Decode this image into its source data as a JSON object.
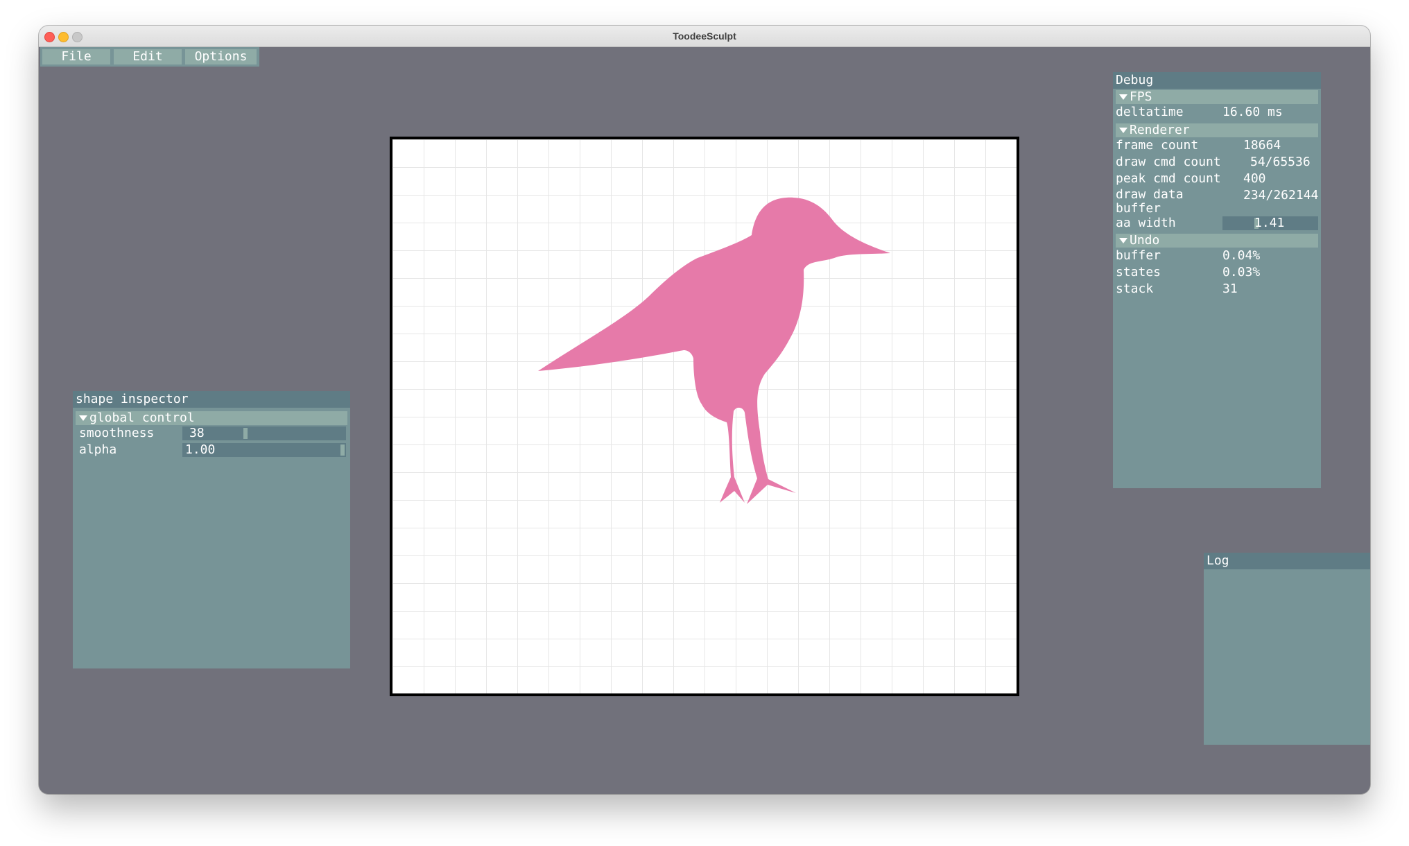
{
  "window": {
    "title": "ToodeeSculpt"
  },
  "menubar": {
    "items": [
      {
        "label": "File"
      },
      {
        "label": "Edit"
      },
      {
        "label": "Options"
      }
    ]
  },
  "shape_inspector": {
    "title": "shape inspector",
    "section": "global control",
    "rows": [
      {
        "label": "smoothness",
        "value": "38",
        "fraction": 0.38
      },
      {
        "label": "alpha",
        "value": "1.00",
        "fraction": 1.0
      }
    ]
  },
  "canvas": {
    "shape_color": "#e67aa9",
    "shape_name": "bird"
  },
  "debug": {
    "title": "Debug",
    "fps": {
      "section": "FPS",
      "rows": [
        {
          "label": "deltatime",
          "value": "16.60 ms"
        }
      ]
    },
    "renderer": {
      "section": "Renderer",
      "rows": [
        {
          "label": "frame count",
          "value": "18664"
        },
        {
          "label": "draw cmd count",
          "value": "54/65536"
        },
        {
          "label": "peak cmd count",
          "value": "400"
        },
        {
          "label": "draw data\nbuffer",
          "value": "234/262144"
        }
      ],
      "aa_width": {
        "label": "aa width",
        "value": "1.41"
      }
    },
    "undo": {
      "section": "Undo",
      "rows": [
        {
          "label": "buffer",
          "value": "0.04%"
        },
        {
          "label": "states",
          "value": "0.03%"
        },
        {
          "label": "stack",
          "value": "31"
        }
      ]
    }
  },
  "log": {
    "title": "Log"
  }
}
